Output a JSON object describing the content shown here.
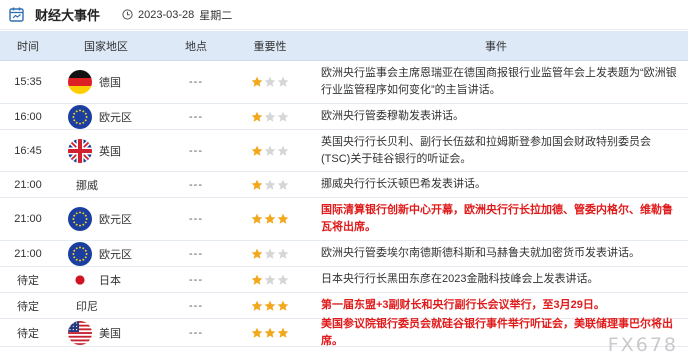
{
  "header": {
    "title": "财经大事件",
    "date": "2023-03-28",
    "weekday": "星期二"
  },
  "columns": {
    "time": "时间",
    "country": "国家地区",
    "location": "地点",
    "importance": "重要性",
    "event": "事件"
  },
  "colors": {
    "header_bg": "#dde9f6",
    "highlight": "#e01b1b",
    "star_on": "#f2a81d",
    "star_off": "#d6d6d6"
  },
  "rows": [
    {
      "time": "15:35",
      "flag": "germany-flag",
      "country": "德国",
      "location": "---",
      "stars": 1,
      "highlight": false,
      "event": "欧洲央行监事会主席恩瑞亚在德国商报银行业监管年会上发表题为“欧洲银行业监管程序如何变化”的主旨讲话。"
    },
    {
      "time": "16:00",
      "flag": "eu-flag",
      "country": "欧元区",
      "location": "---",
      "stars": 1,
      "highlight": false,
      "event": "欧洲央行管委穆勒发表讲话。"
    },
    {
      "time": "16:45",
      "flag": "uk-flag",
      "country": "英国",
      "location": "---",
      "stars": 1,
      "highlight": false,
      "event": "英国央行行长贝利、副行长伍兹和拉姆斯登参加国会财政特别委员会(TSC)关于硅谷银行的听证会。"
    },
    {
      "time": "21:00",
      "flag": "",
      "country": "挪威",
      "location": "---",
      "stars": 1,
      "highlight": false,
      "event": "挪威央行行长沃顿巴希发表讲话。"
    },
    {
      "time": "21:00",
      "flag": "eu-flag",
      "country": "欧元区",
      "location": "---",
      "stars": 3,
      "highlight": true,
      "event": "国际清算银行创新中心开幕，欧洲央行行长拉加德、管委内格尔、维勒鲁瓦将出席。"
    },
    {
      "time": "21:00",
      "flag": "eu-flag",
      "country": "欧元区",
      "location": "---",
      "stars": 1,
      "highlight": false,
      "event": "欧洲央行管委埃尔南德斯德科斯和马赫鲁夫就加密货币发表讲话。"
    },
    {
      "time": "待定",
      "flag": "japan-flag",
      "country": "日本",
      "location": "---",
      "stars": 1,
      "highlight": false,
      "event": "日本央行行长黑田东彦在2023金融科技峰会上发表讲话。"
    },
    {
      "time": "待定",
      "flag": "",
      "country": "印尼",
      "location": "---",
      "stars": 3,
      "highlight": true,
      "event": "第一届东盟+3副财长和央行副行长会议举行，至3月29日。"
    },
    {
      "time": "待定",
      "flag": "us-flag",
      "country": "美国",
      "location": "---",
      "stars": 3,
      "highlight": true,
      "event": "美国参议院银行委员会就硅谷银行事件举行听证会，美联储理事巴尔将出席。"
    }
  ],
  "watermark": "FX678"
}
